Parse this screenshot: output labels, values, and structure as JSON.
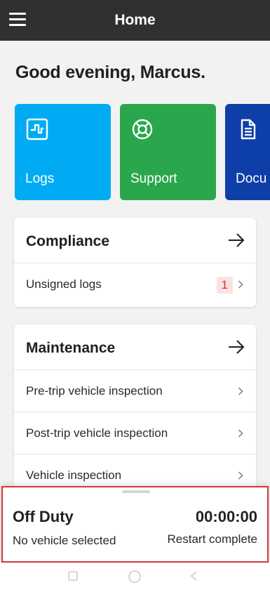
{
  "header": {
    "title": "Home",
    "menu_icon": "hamburger-menu-icon"
  },
  "greeting": "Good evening, Marcus.",
  "tiles": [
    {
      "label": "Logs",
      "icon": "logs-icon",
      "color": "#00abf3"
    },
    {
      "label": "Support",
      "icon": "lifebuoy-icon",
      "color": "#2aa74c"
    },
    {
      "label": "Docu",
      "icon": "document-icon",
      "color": "#0e3fa8"
    }
  ],
  "compliance": {
    "title": "Compliance",
    "items": [
      {
        "label": "Unsigned logs",
        "badge": "1"
      }
    ]
  },
  "maintenance": {
    "title": "Maintenance",
    "items": [
      {
        "label": "Pre-trip vehicle inspection"
      },
      {
        "label": "Post-trip vehicle inspection"
      },
      {
        "label": "Vehicle inspection"
      }
    ]
  },
  "status": {
    "duty": "Off Duty",
    "timer": "00:00:00",
    "vehicle": "No vehicle selected",
    "restart": "Restart complete"
  },
  "colors": {
    "topbar": "#303030",
    "alert": "#d7373a",
    "badge_bg": "#fde0df",
    "badge_text": "#c93a3a"
  }
}
